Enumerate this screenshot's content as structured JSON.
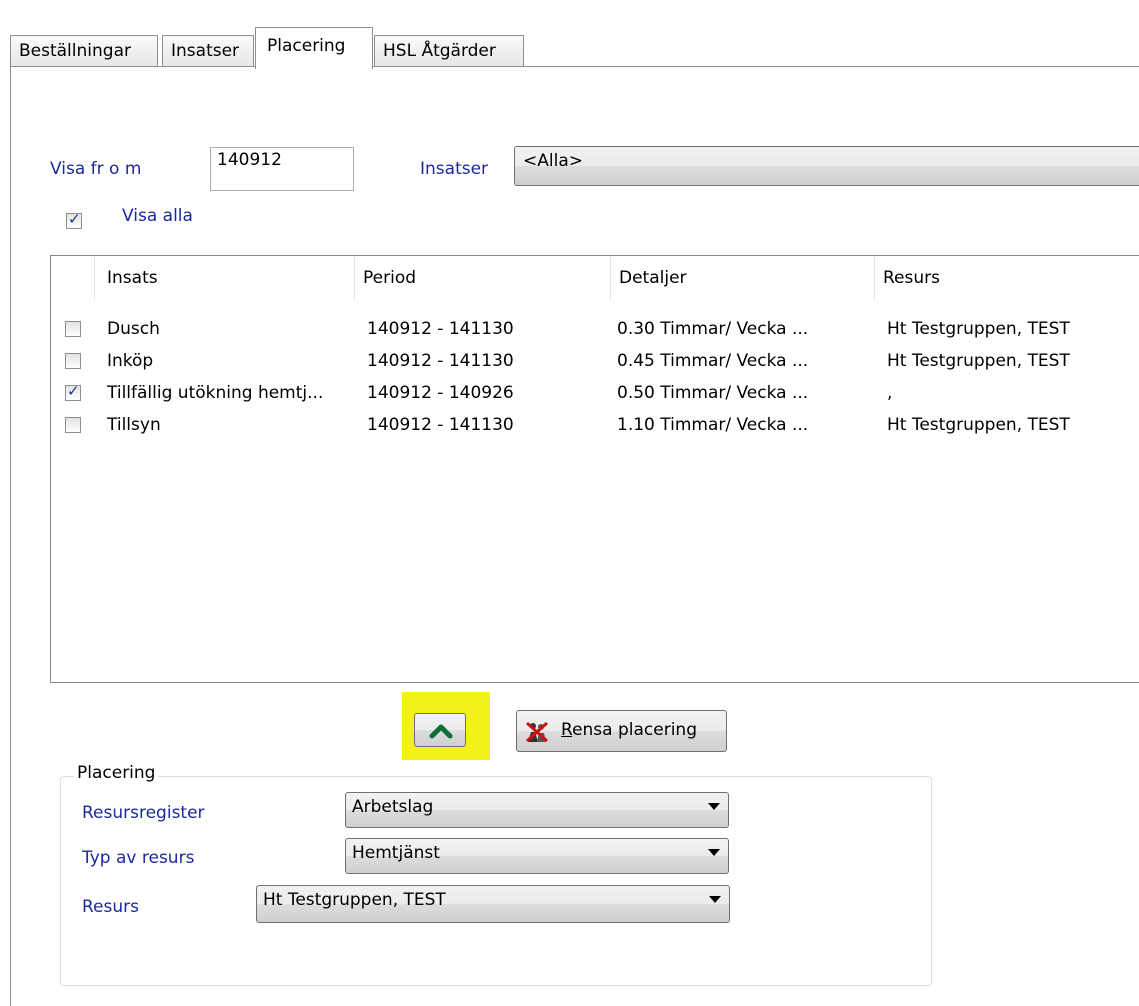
{
  "tabs": [
    {
      "label": "Beställningar"
    },
    {
      "label": "Insatser"
    },
    {
      "label": "Placering",
      "active": true
    },
    {
      "label": "HSL Åtgärder"
    }
  ],
  "filter": {
    "visa_fr_o_m_label": "Visa fr o m",
    "visa_fr_o_m_value": "140912",
    "insatser_label": "Insatser",
    "insatser_value": "<Alla>",
    "visa_alla_label": "Visa alla",
    "visa_alla_checked": true
  },
  "list": {
    "columns": [
      "Insats",
      "Period",
      "Detaljer",
      "Resurs"
    ],
    "rows": [
      {
        "checked": false,
        "insats": "Dusch",
        "period": "140912 - 141130",
        "detaljer": "0.30 Timmar/ Vecka  ...",
        "resurs": "Ht Testgruppen, TEST"
      },
      {
        "checked": false,
        "insats": "Inköp",
        "period": "140912 - 141130",
        "detaljer": "0.45 Timmar/ Vecka  ...",
        "resurs": "Ht Testgruppen, TEST"
      },
      {
        "checked": true,
        "insats": "Tillfällig utökning hemtj...",
        "period": "140912 - 140926",
        "detaljer": "0.50 Timmar/ Vecka  ...",
        "resurs": ","
      },
      {
        "checked": false,
        "insats": "Tillsyn",
        "period": "140912 - 141130",
        "detaljer": "1.10 Timmar/ Vecka  ...",
        "resurs": "Ht Testgruppen, TEST"
      }
    ]
  },
  "buttons": {
    "move_up_icon": "chevron-up-icon",
    "rensa_underline": "R",
    "rensa_rest": "ensa placering",
    "rensa_icon": "clear-placement-icon"
  },
  "placering": {
    "title": "Placering",
    "resursregister_label": "Resursregister",
    "resursregister_value": "Arbetslag",
    "typ_label": "Typ av resurs",
    "typ_value": "Hemtjänst",
    "resurs_label": "Resurs",
    "resurs_value": "Ht Testgruppen, TEST"
  },
  "colors": {
    "label_blue": "#1a2a9c",
    "highlight": "#f2f21a",
    "up_arrow": "#0f6f3a"
  }
}
